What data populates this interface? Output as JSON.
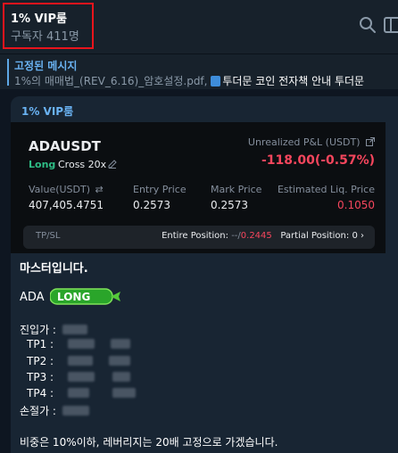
{
  "header": {
    "title": "1% VIP룸",
    "subscribers": "구독자 411명"
  },
  "pinned": {
    "title": "고정된 메시지",
    "text": "1%의 매매법_(REV_6.16)_암호설정.pdf,",
    "book_text": "투더문 코인 전자책 안내  투더문"
  },
  "message": {
    "sender": "1% VIP룸",
    "card": {
      "symbol": "ADAUSDT",
      "side": "Long",
      "margin_mode": "Cross 20x",
      "upnl_label": "Unrealized P&L (USDT)",
      "upnl_value": "-118.00(-0.57%)",
      "columns": [
        {
          "label": "Value(USDT)",
          "value": "407,405.4751"
        },
        {
          "label": "Entry Price",
          "value": "0.2573"
        },
        {
          "label": "Mark Price",
          "value": "0.2573"
        },
        {
          "label": "Estimated Liq. Price",
          "value": "0.1050"
        }
      ],
      "tpsl_label": "TP/SL",
      "entire_position_label": "Entire Position:",
      "entire_position_value_a": "--",
      "entire_position_sep": "/",
      "entire_position_value_b": "0.2445",
      "partial_position_label": "Partial Position:",
      "partial_position_value": "0"
    },
    "greeting": "마스터입니다.",
    "coin": "ADA",
    "badge": "LONG",
    "lines": [
      {
        "label": "진입가 :"
      },
      {
        "label": "TP1   :"
      },
      {
        "label": "TP2   :"
      },
      {
        "label": "TP3   :"
      },
      {
        "label": "TP4   :"
      },
      {
        "label": "손절가 :"
      }
    ],
    "footer": "비중은 10%이하, 레버리지는 20배 고정으로 가겠습니다."
  },
  "colors": {
    "background": "#0e1621",
    "accent": "#6ab3f3",
    "long_green": "#2ebd85",
    "loss_red": "#f6465d",
    "highlight_box": "#e8141c"
  }
}
